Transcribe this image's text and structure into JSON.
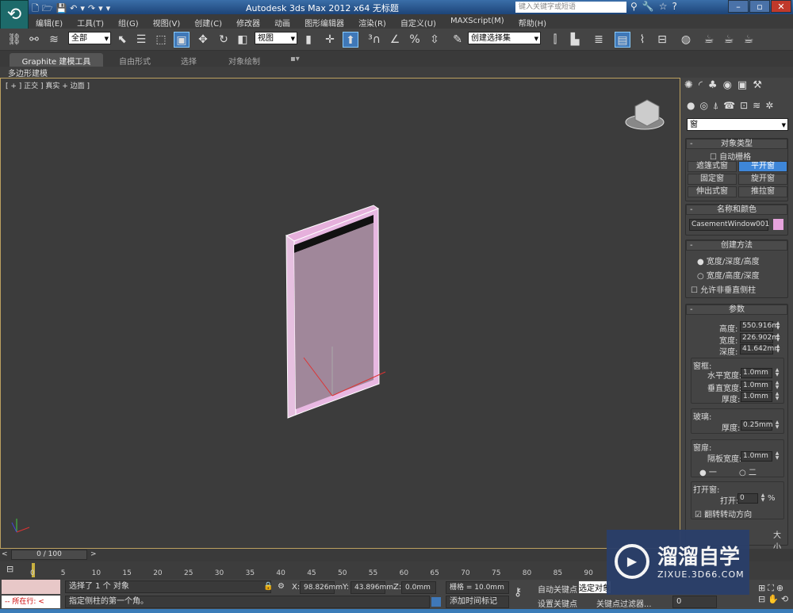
{
  "titlebar": {
    "title": "Autodesk 3ds Max  2012 x64     无标题",
    "search_placeholder": "键入关键字或短语"
  },
  "menu": [
    "编辑(E)",
    "工具(T)",
    "组(G)",
    "视图(V)",
    "创建(C)",
    "修改器",
    "动画",
    "图形编辑器",
    "渲染(R)",
    "自定义(U)",
    "MAXScript(M)",
    "帮助(H)"
  ],
  "toolbar": {
    "selection_filter": "全部",
    "ref_coord": "视图",
    "named_selection": "创建选择集"
  },
  "ribbon": {
    "tabs": [
      "Graphite 建模工具",
      "自由形式",
      "选择",
      "对象绘制"
    ],
    "sub": "多边形建模"
  },
  "viewport": {
    "label": "[ + ] 正交 ] 真实 + 边面 ]",
    "object_color": "#e6a3dc"
  },
  "command_panel": {
    "category": "窗",
    "object_type": {
      "title": "对象类型",
      "autogrid": "自动栅格",
      "buttons": [
        "遮篷式窗",
        "平开窗",
        "固定窗",
        "旋开窗",
        "伸出式窗",
        "推拉窗"
      ],
      "active": "平开窗"
    },
    "name_color": {
      "title": "名称和颜色",
      "name": "CasementWindow001",
      "color": "#e6a3dc"
    },
    "creation_method": {
      "title": "创建方法",
      "options": [
        "宽度/深度/高度",
        "宽度/高度/深度"
      ],
      "selected": 0,
      "allow_non_vertical": "允许非垂直侧柱"
    },
    "params": {
      "title": "参数",
      "height_label": "高度:",
      "height": "550.916m",
      "width_label": "宽度:",
      "width": "226.902m",
      "depth_label": "深度:",
      "depth": "41.642mn",
      "frame": {
        "title": "窗框:",
        "h_label": "水平宽度:",
        "h": "1.0mm",
        "v_label": "垂直宽度:",
        "v": "1.0mm",
        "t_label": "厚度:",
        "t": "1.0mm"
      },
      "glass": {
        "title": "玻璃:",
        "t_label": "厚度:",
        "t": "0.25mm"
      },
      "casement": {
        "title": "窗扉:",
        "panel_label": "隔板宽度:",
        "panel": "1.0mm",
        "opt1": "一",
        "opt2": "二",
        "selected": "一"
      },
      "open": {
        "title": "打开窗:",
        "open_label": "打开:",
        "open": "0",
        "pct": "%",
        "flip": "翻转转动方向",
        "flip_checked": true
      },
      "extra": "大小"
    }
  },
  "timeline": {
    "frame": "0 / 100",
    "ticks": [
      "0",
      "5",
      "10",
      "15",
      "20",
      "25",
      "30",
      "35",
      "40",
      "45",
      "50",
      "55",
      "60",
      "65",
      "70",
      "75",
      "80",
      "85",
      "90"
    ]
  },
  "status": {
    "listener": "所在行:",
    "selected": "选择了 1 个 对象",
    "prompt": "指定侧柱的第一个角。",
    "x_label": "X:",
    "x": "98.826mm",
    "y_label": "Y:",
    "y": "43.896mm",
    "z_label": "Z:",
    "z": "0.0mm",
    "grid": "栅格 = 10.0mm",
    "add_time_tag": "添加时间标记",
    "auto_key": "自动关键点",
    "selected_obj": "选定对象",
    "set_key": "设置关键点",
    "key_filters": "关键点过滤器...",
    "frame_field": "0"
  },
  "watermark": {
    "brand": "溜溜自学",
    "url": "ZIXUE.3D66.COM"
  }
}
